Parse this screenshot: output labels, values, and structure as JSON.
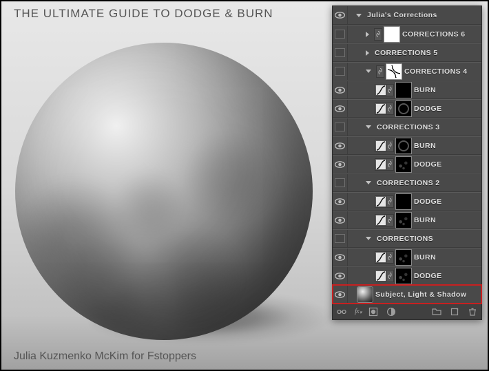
{
  "title": "THE ULTIMATE GUIDE TO DODGE & BURN",
  "credit": "Julia Kuzmenko McKim for Fstoppers",
  "subject": {
    "label": "Subject, Light & Shadow"
  },
  "layers": [
    {
      "kind": "group",
      "name": "Julia's Corrections",
      "expanded": true,
      "visible": true,
      "depth": 0
    },
    {
      "kind": "group",
      "name": "CORRECTIONS 6",
      "expanded": false,
      "visible": false,
      "depth": 1,
      "linkmask": true,
      "mask": "white"
    },
    {
      "kind": "group",
      "name": "CORRECTIONS 5",
      "expanded": false,
      "visible": false,
      "depth": 1
    },
    {
      "kind": "group",
      "name": "CORRECTIONS 4",
      "expanded": true,
      "visible": false,
      "depth": 1,
      "linkmask": true,
      "mask": "curves"
    },
    {
      "kind": "adj",
      "name": "BURN",
      "visible": true,
      "depth": 2,
      "mask": "black"
    },
    {
      "kind": "adj",
      "name": "DODGE",
      "visible": true,
      "depth": 2,
      "mask": "ring"
    },
    {
      "kind": "group",
      "name": "CORRECTIONS 3",
      "expanded": true,
      "visible": false,
      "depth": 1
    },
    {
      "kind": "adj",
      "name": "BURN",
      "visible": true,
      "depth": 2,
      "mask": "ring"
    },
    {
      "kind": "adj",
      "name": "DODGE",
      "visible": true,
      "depth": 2,
      "mask": "speck"
    },
    {
      "kind": "group",
      "name": "CORRECTIONS 2",
      "expanded": true,
      "visible": false,
      "depth": 1
    },
    {
      "kind": "adj",
      "name": "DODGE",
      "visible": true,
      "depth": 2,
      "mask": "black"
    },
    {
      "kind": "adj",
      "name": "BURN",
      "visible": true,
      "depth": 2,
      "mask": "speck"
    },
    {
      "kind": "group",
      "name": "CORRECTIONS",
      "expanded": true,
      "visible": false,
      "depth": 1
    },
    {
      "kind": "adj",
      "name": "BURN",
      "visible": true,
      "depth": 2,
      "mask": "speck"
    },
    {
      "kind": "adj",
      "name": "DODGE",
      "visible": true,
      "depth": 2,
      "mask": "speck"
    }
  ],
  "footer_icons": [
    "link-icon",
    "fx-icon",
    "mask-icon",
    "adjustment-icon",
    "group-icon",
    "new-layer-icon",
    "trash-icon"
  ]
}
